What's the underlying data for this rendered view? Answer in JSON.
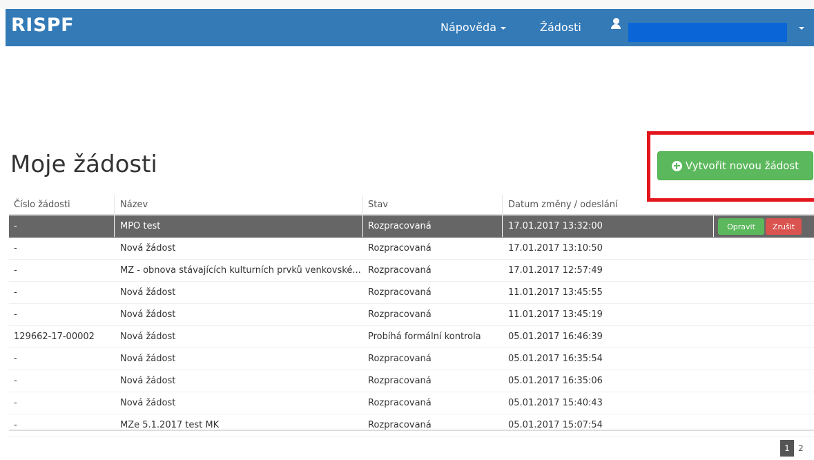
{
  "app": {
    "brand": "RISPF"
  },
  "navbar": {
    "help_label": "Nápověda",
    "requests_label": "Žádosti",
    "user_icon": "user-icon"
  },
  "page": {
    "title": "Moje žádosti",
    "create_button": "Vytvořit novou žádost",
    "create_icon": "plus-circle-icon"
  },
  "table": {
    "headers": [
      "Číslo žádosti",
      "Název",
      "Stav",
      "Datum změny / odeslání"
    ],
    "rows": [
      {
        "number": "-",
        "name": "MPO test",
        "status": "Rozpracovaná",
        "date": "17.01.2017 13:32:00",
        "selected": true
      },
      {
        "number": "-",
        "name": "Nová žádost",
        "status": "Rozpracovaná",
        "date": "17.01.2017 13:10:50"
      },
      {
        "number": "-",
        "name": "MZ - obnova stávajících kulturních prvků venkovské...",
        "status": "Rozpracovaná",
        "date": "17.01.2017 12:57:49"
      },
      {
        "number": "-",
        "name": "Nová žádost",
        "status": "Rozpracovaná",
        "date": "11.01.2017 13:45:55"
      },
      {
        "number": "-",
        "name": "Nová žádost",
        "status": "Rozpracovaná",
        "date": "11.01.2017 13:45:19"
      },
      {
        "number": "129662-17-00002",
        "name": "Nová žádost",
        "status": "Probíhá formální kontrola",
        "date": "05.01.2017 16:46:39"
      },
      {
        "number": "-",
        "name": "Nová žádost",
        "status": "Rozpracovaná",
        "date": "05.01.2017 16:35:54"
      },
      {
        "number": "-",
        "name": "Nová žádost",
        "status": "Rozpracovaná",
        "date": "05.01.2017 16:35:06"
      },
      {
        "number": "-",
        "name": "Nová žádost",
        "status": "Rozpracovaná",
        "date": "05.01.2017 15:40:43"
      },
      {
        "number": "-",
        "name": "MZe 5.1.2017 test MK",
        "status": "Rozpracovaná",
        "date": "05.01.2017 15:07:54"
      }
    ],
    "row_actions": {
      "edit": "Opravit",
      "cancel": "Zrušit"
    }
  },
  "pagination": {
    "pages": [
      "1",
      "2"
    ],
    "active": "1"
  },
  "colors": {
    "navbar": "#337ab7",
    "success": "#5cb85c",
    "danger": "#d9534f",
    "highlight": "#e3141c",
    "selected_row": "#666666"
  }
}
